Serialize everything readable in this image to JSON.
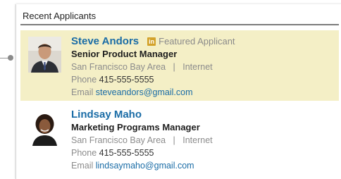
{
  "panel": {
    "title": "Recent Applicants",
    "colors": {
      "featured_bg": "#f4efc6",
      "link": "#1a6ca6",
      "badge": "#d3a22b"
    }
  },
  "applicants": [
    {
      "name": "Steve Andors",
      "featured_badge_icon": "linkedin-in-icon",
      "featured_label": "Featured Applicant",
      "title": "Senior Product Manager",
      "location": "San Francisco Bay Area",
      "separator": "|",
      "industry": "Internet",
      "phone_label": "Phone",
      "phone": "415-555-5555",
      "email_label": "Email",
      "email": "steveandors@gmail.com"
    },
    {
      "name": "Lindsay Maho",
      "title": "Marketing Programs Manager",
      "location": "San Francisco Bay Area",
      "separator": "|",
      "industry": "Internet",
      "phone_label": "Phone",
      "phone": "415-555-5555",
      "email_label": "Email",
      "email": "lindsaymaho@gmail.com"
    }
  ]
}
